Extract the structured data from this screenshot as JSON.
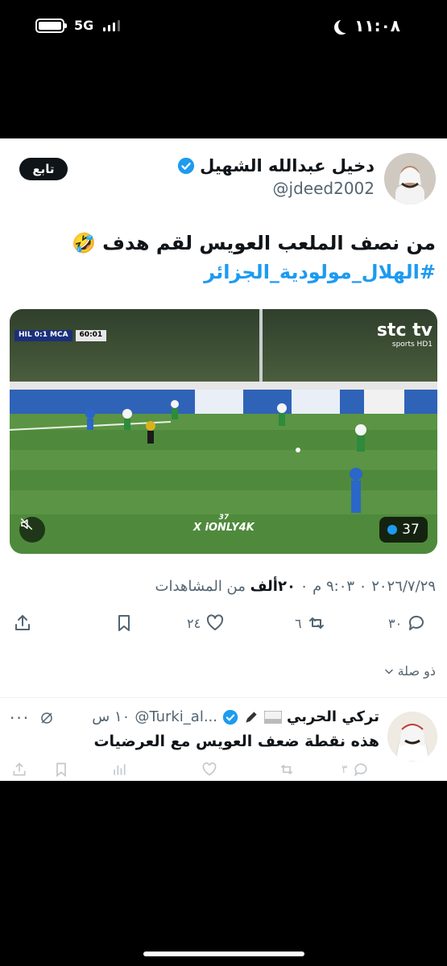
{
  "status_bar": {
    "network": "5G",
    "time": "١١:٠٨"
  },
  "tweet": {
    "author": {
      "display_name": "دخيل عبدالله الشهيل",
      "handle": "@jdeed2002"
    },
    "follow_label": "تابع",
    "text_line1": "من نصف الملعب العويس لقم هدف 🤣",
    "hashtag": "#الهلال_مولودية_الجزائر",
    "media": {
      "scoreboard_teams": "HIL 0:1 MCA",
      "scoreboard_clock": "60:01",
      "broadcaster": "stc tv",
      "broadcaster_sub": "sports HD1",
      "watermark_num": "37",
      "watermark": "X iONLY4K",
      "media_count": "37"
    },
    "meta": {
      "date_time": "٢٠٢٦/٧/٢٩ ٠ ٩:٠٣ م ٠ ",
      "views_count": "٢٠ألف",
      "views_label": " من المشاهدات"
    },
    "actions": {
      "replies": "٣٠",
      "retweets": "٦",
      "likes": "٢٤"
    },
    "thread_label": "ذو صلة"
  },
  "reply": {
    "display_name": "تركي الحربي",
    "handle": "@Turki_al...",
    "time": "١٠ س",
    "text": "هذه نقطة ضعف العويس مع العرضيات",
    "replies": "٣"
  },
  "colors": {
    "accent": "#1d9bf0",
    "text": "#0f1419",
    "muted": "#536471",
    "pitch": "#3f7a32"
  }
}
